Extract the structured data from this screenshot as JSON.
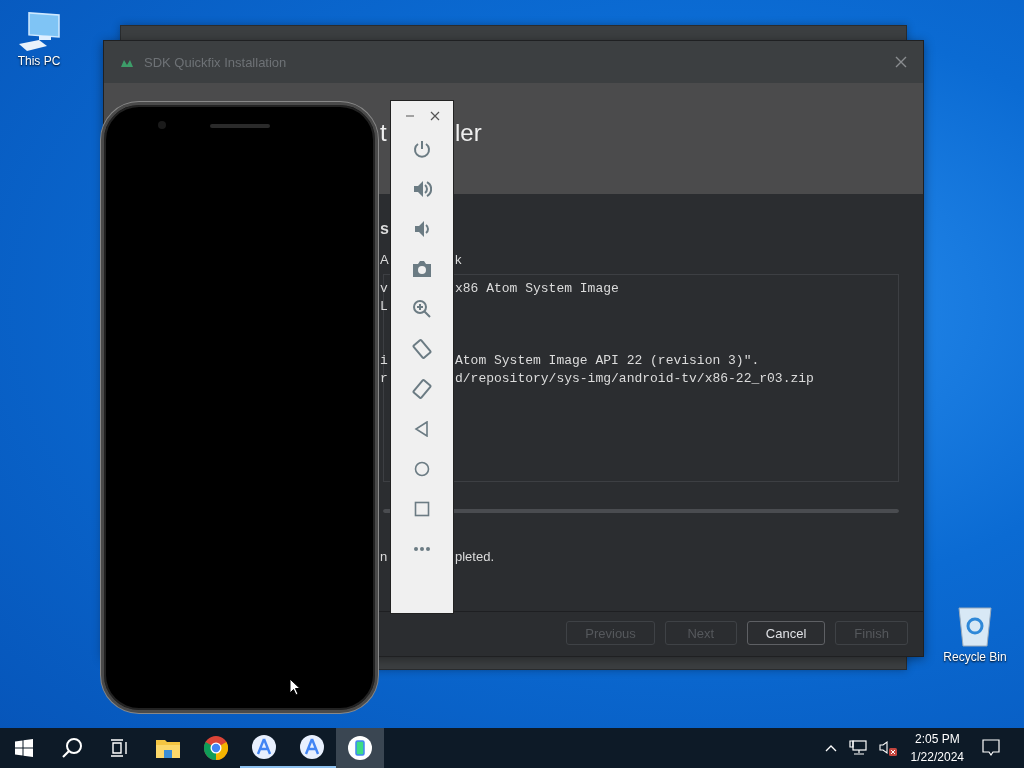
{
  "desktop_icons": [
    {
      "kind": "pc",
      "label": "This PC"
    },
    {
      "kind": "bin",
      "label": "Recycle Bin"
    }
  ],
  "dialog": {
    "title": "SDK Quickfix Installation",
    "header": {
      "left": "t",
      "right": "ler"
    },
    "section": "s",
    "subtitle": {
      "left": "A",
      "right": "k"
    },
    "log": [
      [
        {
          "left": "v",
          "right": "x86 Atom System Image"
        },
        {
          "left": "L"
        }
      ],
      [
        {
          "left": "i",
          "right": "Atom System Image API 22 (revision 3)\"."
        },
        {
          "left": "r",
          "right": "d/repository/sys-img/android-tv/x86-22_r03.zip"
        }
      ]
    ],
    "progress": {
      "level": 1
    },
    "status": {
      "left": "n",
      "right": "pleted."
    },
    "buttons": [
      {
        "label": "Previous",
        "disabled": true
      },
      {
        "label": "Next",
        "disabled": true
      },
      {
        "label": "Cancel",
        "disabled": false
      },
      {
        "label": "Finish",
        "disabled": true
      }
    ]
  },
  "taskbar": {
    "apps": [
      {
        "kind": "folder",
        "running": false,
        "selected": false
      },
      {
        "kind": "browser",
        "running": false,
        "selected": false
      },
      {
        "kind": "studio",
        "running": true,
        "selected": false
      },
      {
        "kind": "studio",
        "running": true,
        "selected": false
      },
      {
        "kind": "emulator",
        "running": false,
        "selected": true
      }
    ],
    "tray": {
      "muted": true,
      "time": "2:05 PM",
      "date": "1/22/2024"
    }
  }
}
